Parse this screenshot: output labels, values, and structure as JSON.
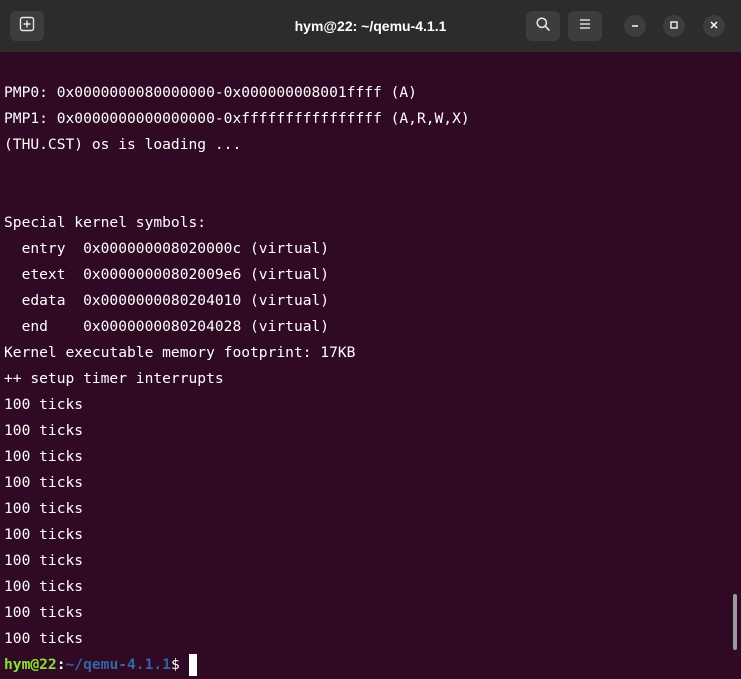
{
  "window": {
    "title": "hym@22: ~/qemu-4.1.1"
  },
  "icons": {
    "new_tab": "new-tab-icon",
    "search": "search-icon",
    "menu": "hamburger-menu-icon",
    "minimize": "minimize-icon",
    "maximize": "maximize-icon",
    "close": "close-icon"
  },
  "colors": {
    "terminal_bg": "#300a24",
    "titlebar_bg": "#2c2c2c",
    "prompt_user": "#8ae234",
    "prompt_path": "#3465a4",
    "text": "#ffffff"
  },
  "terminal": {
    "lines": [
      "PMP0: 0x0000000080000000-0x000000008001ffff (A)",
      "PMP1: 0x0000000000000000-0xffffffffffffffff (A,R,W,X)",
      "(THU.CST) os is loading ...",
      "",
      "",
      "Special kernel symbols:",
      "  entry  0x000000008020000c (virtual)",
      "  etext  0x00000000802009e6 (virtual)",
      "  edata  0x0000000080204010 (virtual)",
      "  end    0x0000000080204028 (virtual)",
      "Kernel executable memory footprint: 17KB",
      "++ setup timer interrupts",
      "100 ticks",
      "100 ticks",
      "100 ticks",
      "100 ticks",
      "100 ticks",
      "100 ticks",
      "100 ticks",
      "100 ticks",
      "100 ticks",
      "100 ticks"
    ],
    "prompt": {
      "user_host": "hym@22",
      "colon": ":",
      "path": "~/qemu-4.1.1",
      "symbol": "$"
    },
    "scroll_position": 0.95,
    "scroll_visible_fraction": 0.09
  }
}
